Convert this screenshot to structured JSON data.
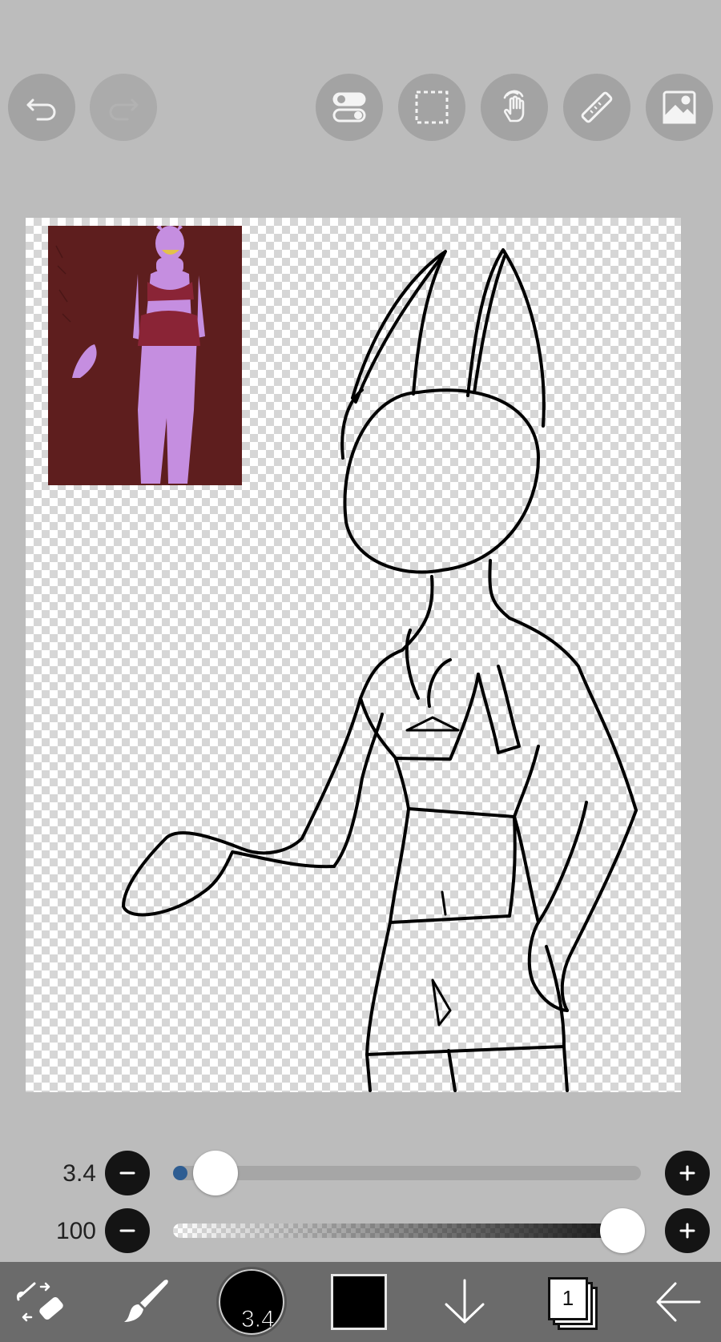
{
  "top_toolbar": {
    "buttons": [
      {
        "icon": "undo-icon",
        "enabled": true
      },
      {
        "icon": "redo-icon",
        "enabled": false
      },
      {
        "icon": "toggle-settings-icon",
        "enabled": true
      },
      {
        "icon": "selection-icon",
        "enabled": true
      },
      {
        "icon": "hand-gesture-icon",
        "enabled": true
      },
      {
        "icon": "ruler-icon",
        "enabled": true
      },
      {
        "icon": "image-icon",
        "enabled": true
      }
    ]
  },
  "brush_size": {
    "label": "3.4",
    "level": 0.03
  },
  "opacity": {
    "label": "100",
    "level": 1.0
  },
  "bottom_bar": {
    "brush_size_label": "3.4",
    "current_color": "#000000",
    "layer_count": "1"
  },
  "colors": {
    "background": "#bcbcbc",
    "toolbar_button": "#a3a3a3",
    "bottom_bar": "#6b6b6b",
    "reference_bg": "#5e1e1e",
    "reference_figure": "#c58ee0",
    "slider_fill": "#2e5d92"
  }
}
